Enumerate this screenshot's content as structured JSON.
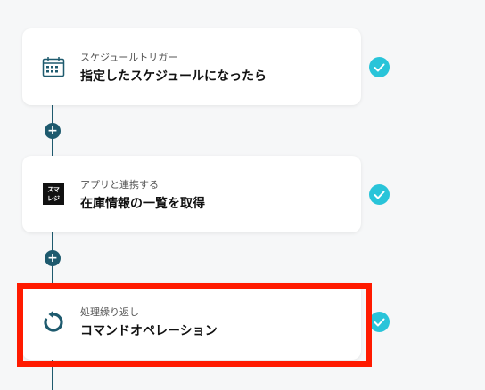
{
  "steps": [
    {
      "subtitle": "スケジュールトリガー",
      "title": "指定したスケジュールになったら",
      "icon": "calendar-icon"
    },
    {
      "subtitle": "アプリと連携する",
      "title": "在庫情報の一覧を取得",
      "icon": "smaregi-logo",
      "logo_text": "スマレジ"
    },
    {
      "subtitle": "処理繰り返し",
      "title": "コマンドオペレーション",
      "icon": "loop-icon"
    }
  ],
  "add_label": "+",
  "colors": {
    "line": "#1e5a6e",
    "check": "#29c4d9",
    "highlight": "#ff1a00",
    "background": "#f6f7f8"
  }
}
